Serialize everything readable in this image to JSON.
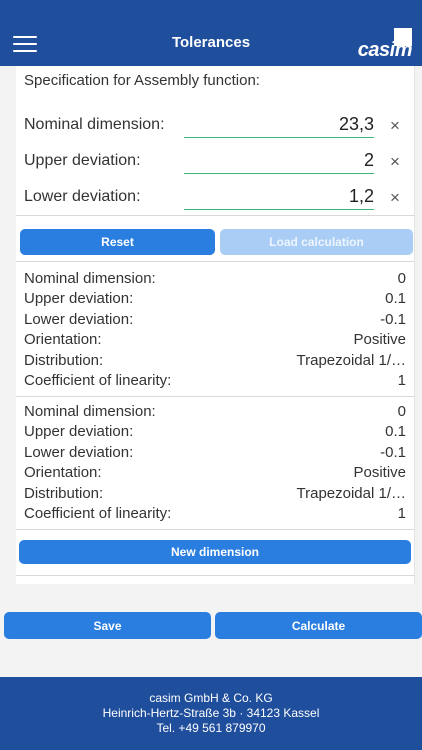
{
  "header": {
    "title": "Tolerances",
    "logo_text": "casim",
    "menu_icon": "hamburger-menu-icon"
  },
  "spec_label": "Specification for Assembly function:",
  "inputs": [
    {
      "label": "Nominal dimension:",
      "value": "23,3",
      "clear": "×"
    },
    {
      "label": "Upper deviation:",
      "value": "2",
      "clear": "×"
    },
    {
      "label": "Lower deviation:",
      "value": "1,2",
      "clear": "×"
    }
  ],
  "buttons": {
    "reset": "Reset",
    "load": "Load calculation",
    "new_dimension": "New dimension",
    "save": "Save",
    "calculate": "Calculate"
  },
  "dimensions": [
    {
      "nominal_label": "Nominal dimension:",
      "nominal": "0",
      "upper_label": "Upper deviation:",
      "upper": "0.1",
      "lower_label": "Lower deviation:",
      "lower": "-0.1",
      "orientation_label": "Orientation:",
      "orientation": "Positive",
      "distribution_label": "Distribution:",
      "distribution": "Trapezoidal 1/…",
      "coef_label": "Coefficient of linearity:",
      "coef": "1"
    },
    {
      "nominal_label": "Nominal dimension:",
      "nominal": "0",
      "upper_label": "Upper deviation:",
      "upper": "0.1",
      "lower_label": "Lower deviation:",
      "lower": "-0.1",
      "orientation_label": "Orientation:",
      "orientation": "Positive",
      "distribution_label": "Distribution:",
      "distribution": "Trapezoidal 1/…",
      "coef_label": "Coefficient of linearity:",
      "coef": "1"
    }
  ],
  "footer": {
    "company": "casim GmbH & Co. KG",
    "address": "Heinrich-Hertz-Straße 3b · 34123 Kassel",
    "phone": "Tel. +49 561 879970"
  },
  "colors": {
    "brand": "#1f4e9c",
    "button": "#2a7ee0",
    "button_disabled": "#a9cdf4",
    "underline": "#3db87a"
  }
}
